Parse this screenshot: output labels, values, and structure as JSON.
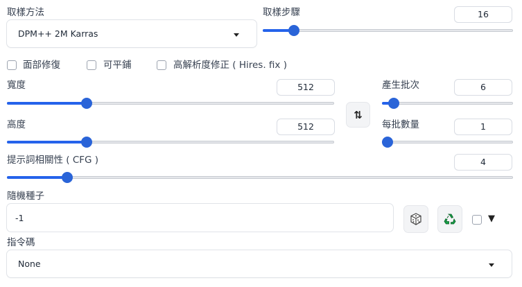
{
  "sampler": {
    "label": "取樣方法",
    "value": "DPM++ 2M Karras"
  },
  "steps": {
    "label": "取樣步驟",
    "value": "16",
    "level": 0.107
  },
  "checkboxes": [
    {
      "label": "面部修復",
      "checked": false
    },
    {
      "label": "可平鋪",
      "checked": false
    },
    {
      "label": "高解析度修正 ( Hires. fix )",
      "checked": false
    }
  ],
  "width": {
    "label": "寬度",
    "value": "512",
    "level": 0.235
  },
  "height": {
    "label": "高度",
    "value": "512",
    "level": 0.235
  },
  "swap_button": {
    "icon": "swap-vertical-arrows-icon",
    "glyph": "⇅"
  },
  "batch_count": {
    "label": "產生批次",
    "value": "6",
    "level": 0.053
  },
  "batch_size": {
    "label": "每批數量",
    "value": "1",
    "level": 0.0
  },
  "cfg": {
    "label": "提示詞相關性 ( CFG )",
    "value": "4",
    "level": 0.111
  },
  "seed": {
    "label": "隨機種子",
    "value": "-1",
    "dice_icon": "dice-icon",
    "recycle_icon": "recycle-icon",
    "extra_toggle_glyph": "▼"
  },
  "script": {
    "label": "指令碼",
    "value": "None"
  },
  "colors": {
    "accent": "#2563eb",
    "thumb": "#2a64d8",
    "recycle": "#16a34a"
  }
}
